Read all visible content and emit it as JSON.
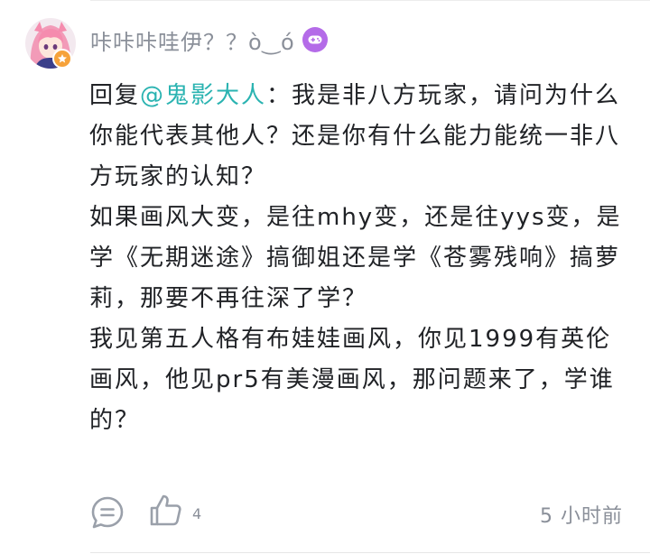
{
  "comment": {
    "username": "咔咔咔哇伊？？ò‿ó",
    "reply_prefix": "回复",
    "mention": "@鬼影大人",
    "reply_sep": "：",
    "paragraphs": [
      "我是非八方玩家，请问为什么你能代表其他人？还是你有什么能力能统一非八方玩家的认知？",
      "如果画风大变，是往mhy变，还是往yys变，是学《无期迷途》搞御姐还是学《苍雾残响》搞萝莉，那要不再往深了学？",
      "我见第五人格有布娃娃画风，你见1999有英伦画风，他见pr5有美漫画风，那问题来了，学谁的？"
    ],
    "like_count": "4",
    "time": "5 小时前"
  },
  "icons": {
    "level_badge": "gamepad-icon",
    "avatar_badge": "star-icon",
    "comment": "comment-bubble-icon",
    "like": "thumbs-up-icon"
  },
  "colors": {
    "mention": "#2ab3b1",
    "level_badge": "#b46be8",
    "avatar_badge": "#f6a23a",
    "muted_text": "#8a8f99",
    "body_text": "#202226"
  }
}
